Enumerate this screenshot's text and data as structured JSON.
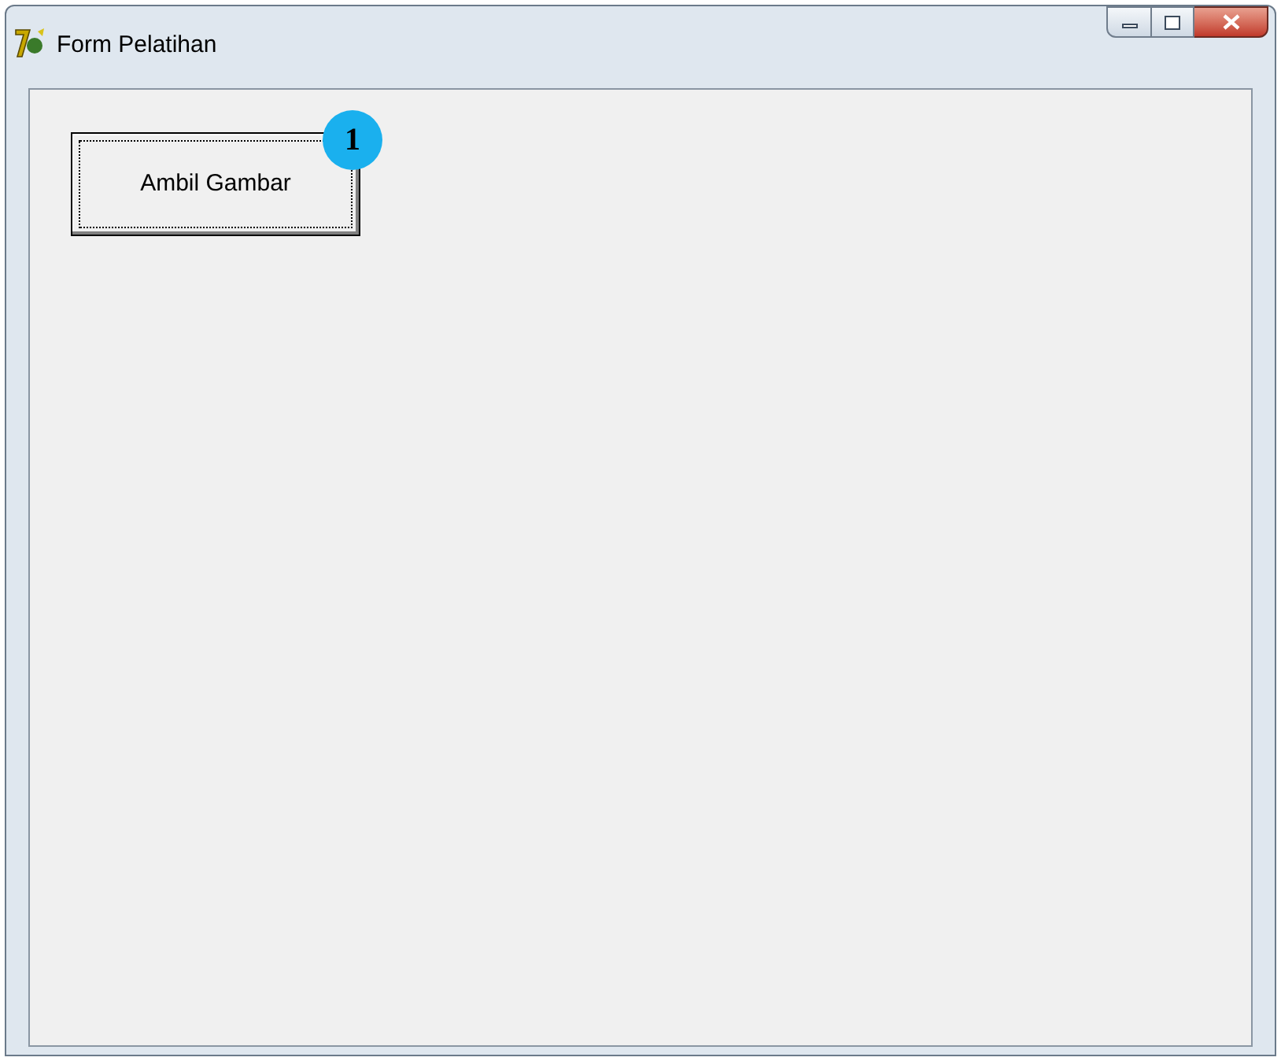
{
  "window": {
    "title": "Form Pelatihan"
  },
  "button": {
    "label": "Ambil Gambar",
    "focused": true,
    "badge": "1"
  }
}
